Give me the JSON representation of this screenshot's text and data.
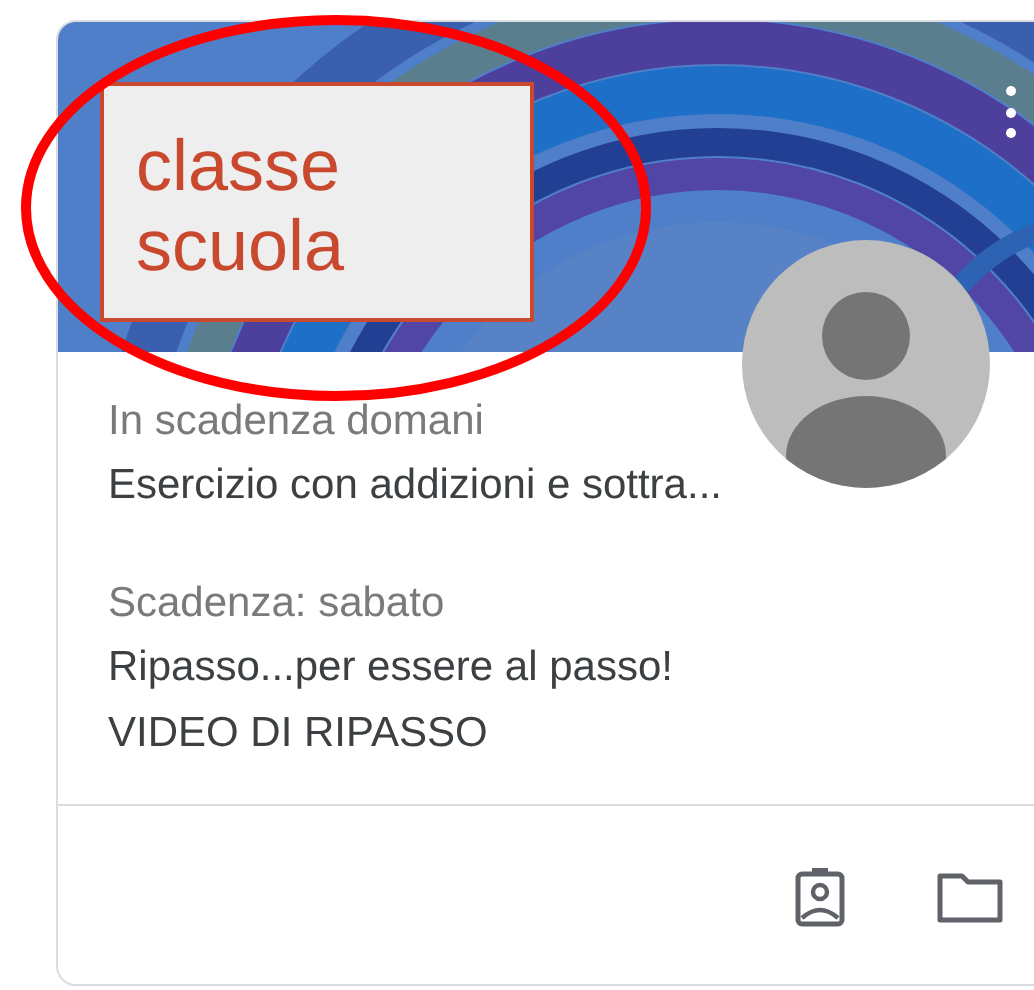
{
  "card": {
    "label": "classe scuola",
    "assignments": [
      {
        "due": "In scadenza domani",
        "title": "Esercizio con addizioni e sottra..."
      },
      {
        "due": "Scadenza: sabato",
        "title": "Ripasso...per essere al passo!",
        "attachment": "VIDEO DI RIPASSO"
      }
    ]
  }
}
